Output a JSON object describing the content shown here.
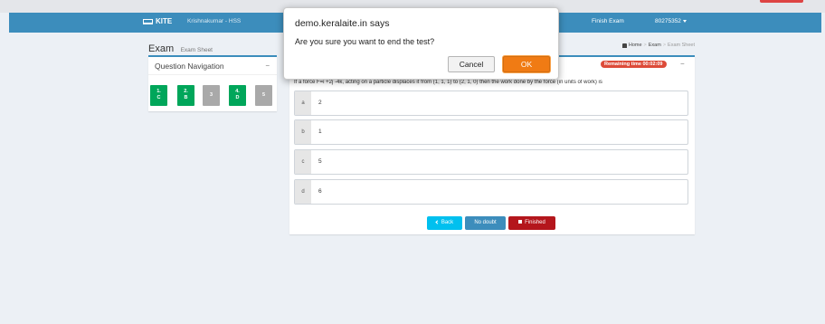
{
  "navbar": {
    "brand": "KITE",
    "user": "Krishnakumar - HSS",
    "finish_exam": "Finish Exam",
    "exam_code": "80275352"
  },
  "header": {
    "title": "Exam",
    "subtitle": "Exam Sheet",
    "breadcrumb": [
      "Home",
      "Exam",
      "Exam Sheet"
    ]
  },
  "question_navigation": {
    "title": "Question Navigation",
    "collapse_label": "−",
    "buttons": [
      {
        "number": "1.",
        "answer": "C",
        "status": "answered"
      },
      {
        "number": "2.",
        "answer": "B",
        "status": "answered"
      },
      {
        "number": "3",
        "answer": "",
        "status": "unanswered"
      },
      {
        "number": "4.",
        "answer": "D",
        "status": "answered"
      },
      {
        "number": "5",
        "answer": "",
        "status": "unanswered"
      }
    ]
  },
  "question": {
    "timer": "Remaining time 00:02:09",
    "collapse_label": "−",
    "text": "If a force F=i +2j -4k, acting on a particle displaces it from (1, 1, 1) to (2, 1, 0) then the work done by the force (in units of work) is",
    "options": [
      {
        "letter": "a",
        "value": "2"
      },
      {
        "letter": "b",
        "value": "1"
      },
      {
        "letter": "c",
        "value": "5"
      },
      {
        "letter": "d",
        "value": "6"
      }
    ]
  },
  "actions": {
    "back": "Back",
    "no_doubt": "No doubt",
    "finished": "Finished"
  },
  "dialog": {
    "site": "demo.keralaite.in says",
    "message": "Are you sure you want to end the test?",
    "cancel": "Cancel",
    "ok": "OK"
  },
  "colors": {
    "navbar": "#3c8dbc",
    "answered": "#00a65a",
    "unanswered": "#a9a9a9",
    "timer": "#dd4b39",
    "ok_button": "#f07b14"
  }
}
